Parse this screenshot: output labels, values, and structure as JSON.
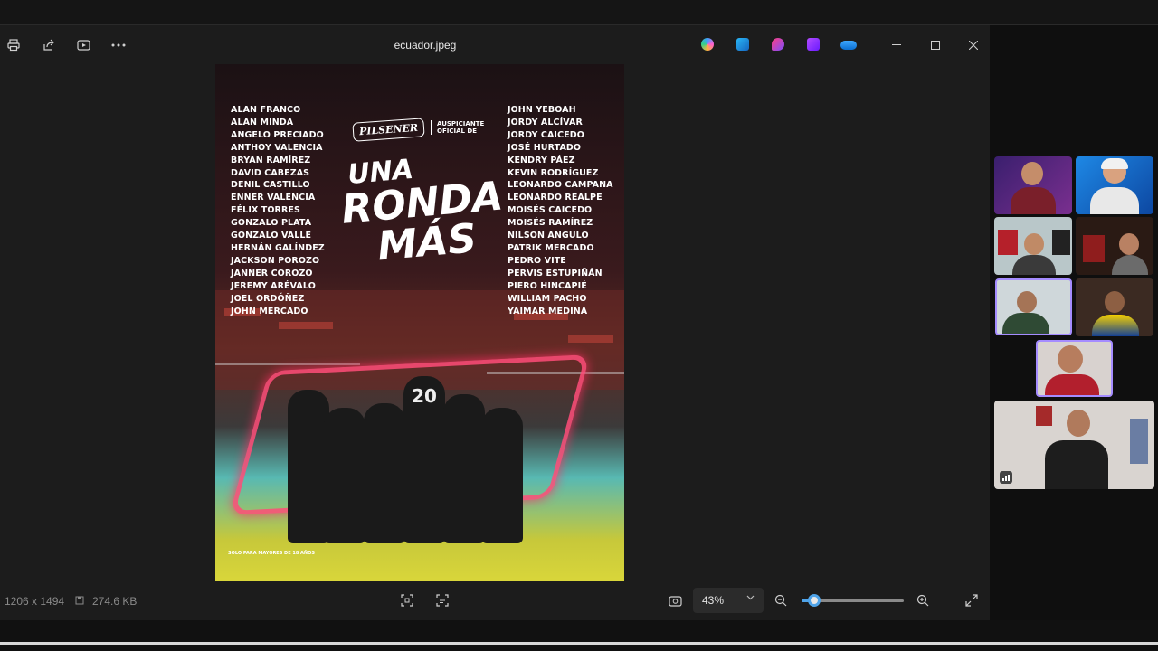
{
  "window": {
    "title": "ecuador.jpeg",
    "toolbar_icons": [
      "print-icon",
      "share-icon",
      "slideshow-icon",
      "more-icon"
    ],
    "app_icons": [
      "copilot-icon",
      "edit-image-icon",
      "designer-icon",
      "clipchamp-icon",
      "onedrive-icon"
    ],
    "window_controls": [
      "minimize-icon",
      "maximize-icon",
      "close-icon"
    ]
  },
  "poster": {
    "roster_left": [
      "ALAN FRANCO",
      "ALAN MINDA",
      "ANGELO PRECIADO",
      "ANTHOY VALENCIA",
      "BRYAN RAMÍREZ",
      "DAVID CABEZAS",
      "DENIL CASTILLO",
      "ENNER VALENCIA",
      "FÉLIX TORRES",
      "GONZALO PLATA",
      "GONZALO VALLE",
      "HERNÁN GALÍNDEZ",
      "JACKSON POROZO",
      "JANNER COROZO",
      "JEREMY ARÉVALO",
      "JOEL ORDÓÑEZ",
      "JOHN MERCADO"
    ],
    "roster_right": [
      "JOHN YEBOAH",
      "JORDY ALCÍVAR",
      "JORDY CAICEDO",
      "JOSÉ HURTADO",
      "KENDRY PÁEZ",
      "KEVIN RODRÍGUEZ",
      "LEONARDO CAMPANA",
      "LEONARDO REALPE",
      "MOISÉS CAICEDO",
      "MOISÉS RAMÍREZ",
      "NILSON ANGULO",
      "PATRIK MERCADO",
      "PEDRO VITE",
      "PERVIS ESTUPIÑÁN",
      "PIERO HINCAPIÉ",
      "WILLIAM PACHO",
      "YAIMAR MEDINA"
    ],
    "sponsor_brand": "PILSENER",
    "sponsor_line1": "AUSPICIANTE",
    "sponsor_line2": "OFICIAL DE",
    "headline_1": "UNA",
    "headline_2": "RONDA",
    "headline_3": "MÁS",
    "jersey_number": "20",
    "disclaimer": "SOLO PARA MAYORES DE 18 AÑOS"
  },
  "status": {
    "dimensions": "1206 x 1494",
    "file_size": "274.6 KB",
    "zoom_label": "43%",
    "zoom_level_fraction": 0.12
  },
  "colors": {
    "viewer_bg": "#1c1c1c",
    "accent": "#4fa3e8"
  }
}
